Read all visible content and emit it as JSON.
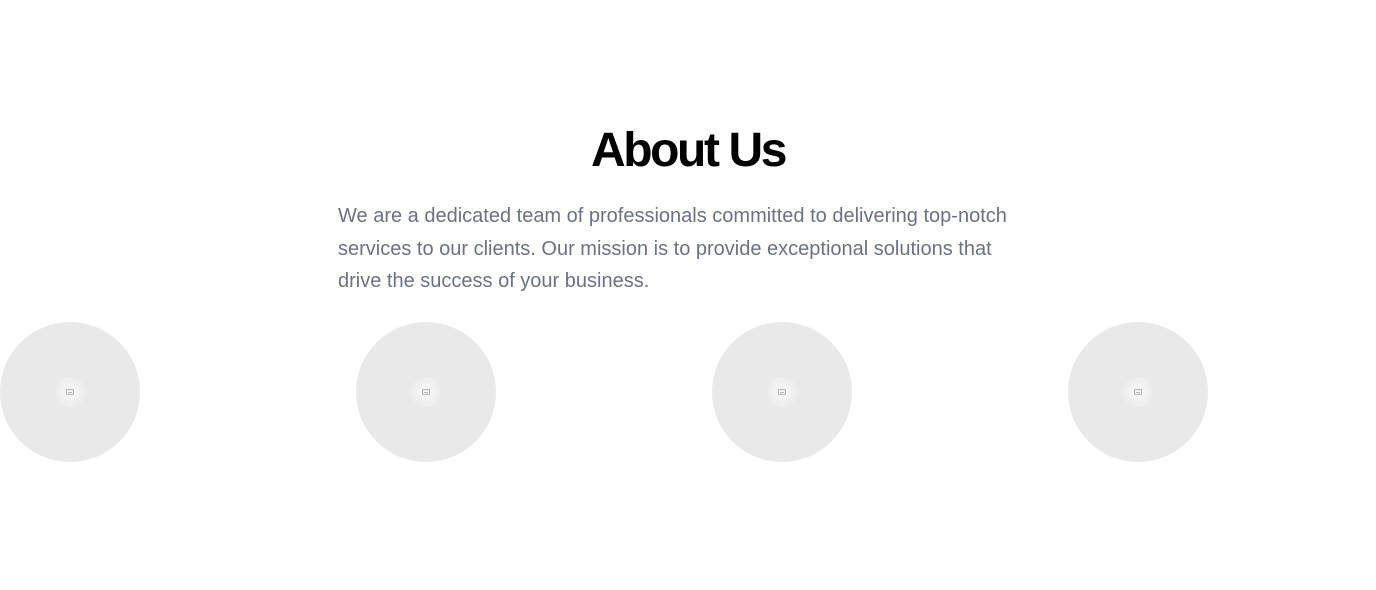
{
  "about": {
    "title": "About Us",
    "description": "We are a dedicated team of professionals committed to delivering top-notch services to our clients. Our mission is to provide exceptional solutions that drive the success of your business."
  },
  "team": {
    "avatars": [
      {
        "icon": "image-placeholder-icon"
      },
      {
        "icon": "image-placeholder-icon"
      },
      {
        "icon": "image-placeholder-icon"
      },
      {
        "icon": "image-placeholder-icon"
      }
    ]
  },
  "colors": {
    "background": "#ffffff",
    "heading": "#000000",
    "body_text": "#6b7280",
    "avatar_placeholder": "#e9e9e9"
  }
}
